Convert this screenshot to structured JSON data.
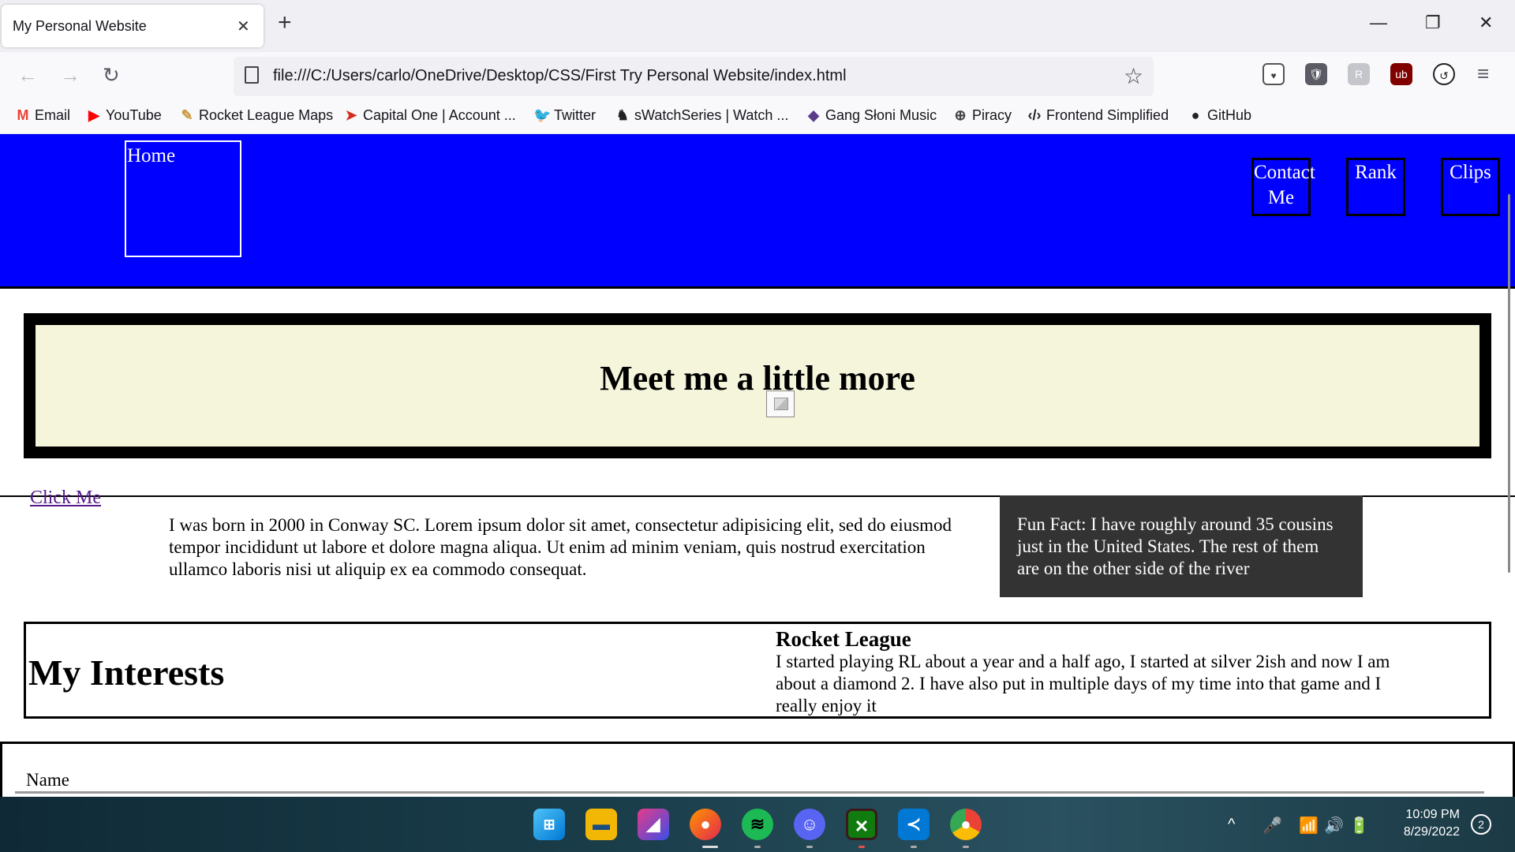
{
  "browser": {
    "tab_title": "My Personal Website",
    "tab_close": "✕",
    "new_tab": "+",
    "window_controls": {
      "minimize": "—",
      "restore": "❐",
      "close": "✕"
    },
    "nav": {
      "back": "←",
      "forward": "→",
      "reload": "↻"
    },
    "url": "file:///C:/Users/carlo/OneDrive/Desktop/CSS/First Try Personal Website/index.html",
    "star": "☆",
    "menu": "≡",
    "bookmarks": [
      {
        "icon": "M",
        "label": "Email",
        "color": "#ea4335"
      },
      {
        "icon": "▶",
        "label": "YouTube",
        "color": "#ff0000"
      },
      {
        "icon": "✎",
        "label": "Rocket League Maps",
        "color": "#c89a3c"
      },
      {
        "icon": "➤",
        "label": "Capital One | Account ...",
        "color": "#d22e1e"
      },
      {
        "icon": "🐦",
        "label": "Twitter",
        "color": "#1d9bf0"
      },
      {
        "icon": "♞",
        "label": "sWatchSeries | Watch ...",
        "color": "#222"
      },
      {
        "icon": "◆",
        "label": "Gang Słoni Music",
        "color": "#5a3d8a"
      },
      {
        "icon": "⊕",
        "label": "Piracy",
        "color": "#444"
      },
      {
        "icon": "‹/›",
        "label": "Frontend Simplified",
        "color": "#222"
      },
      {
        "icon": "●",
        "label": "GitHub",
        "color": "#222"
      }
    ]
  },
  "site": {
    "header": {
      "background": "#0000ff",
      "home": "Home",
      "contact_line1": "Contact",
      "contact_line2": "Me",
      "rank": "Rank",
      "clips": "Clips"
    },
    "hero": {
      "title": "Meet me a little more",
      "background": "#f5f5dc"
    },
    "click_me": "Click Me",
    "bio": "I was born in 2000 in Conway SC. Lorem ipsum dolor sit amet, consectetur adipisicing elit, sed do eiusmod tempor incididunt ut labore et dolore magna aliqua. Ut enim ad minim veniam, quis nostrud exercitation ullamco laboris nisi ut aliquip ex ea commodo consequat.",
    "fun_fact": "Fun Fact: I have roughly around 35 cousins just in the United States. The rest of them are on the other side of the river",
    "interests": {
      "title": "My Interests",
      "item_title": "Rocket League",
      "item_text": "I started playing RL about a year and a half ago, I started at silver 2ish and now I am about a diamond 2. I have also put in multiple days of my time into that game and I really enjoy it"
    },
    "form": {
      "name_label": "Name"
    }
  },
  "taskbar": {
    "time": "10:09 PM",
    "date": "8/29/2022",
    "notifications": "2",
    "tray": {
      "chevron": "^",
      "mic": "🎤",
      "wifi": "📶",
      "volume": "🔊",
      "battery": "🔋"
    }
  }
}
